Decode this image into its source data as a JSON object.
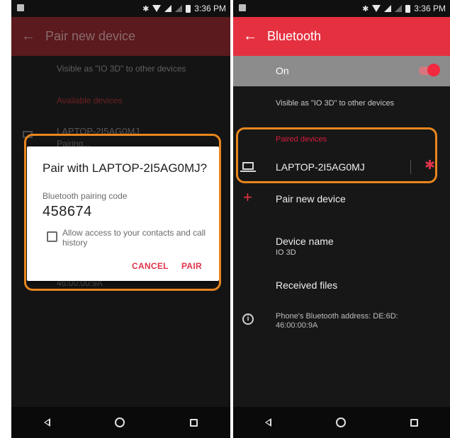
{
  "status_bar": {
    "time": "3:36 PM"
  },
  "left_screen": {
    "title": "Pair new device",
    "visible_as": "Visible as \"IO 3D\" to other devices",
    "available_devices_label": "Available devices",
    "device_name": "LAPTOP-2I5AG0MJ",
    "device_status": "Pairing...",
    "dimmed_address": "46:00:00:9A",
    "dialog": {
      "title": "Pair with LAPTOP-2I5AG0MJ?",
      "code_label": "Bluetooth pairing code",
      "code": "458674",
      "checkbox_label": "Allow access to your contacts and call history",
      "checkbox_checked": false,
      "cancel_label": "CANCEL",
      "pair_label": "PAIR"
    }
  },
  "right_screen": {
    "title": "Bluetooth",
    "toggle_label": "On",
    "toggle_on": true,
    "visible_as": "Visible as \"IO 3D\" to other devices",
    "paired_devices_label": "Paired devices",
    "paired_device": "LAPTOP-2I5AG0MJ",
    "pair_new_label": "Pair new device",
    "device_name_label": "Device name",
    "device_name_value": "IO 3D",
    "received_files_label": "Received files",
    "address_text": "Phone's Bluetooth address: DE:6D: 46:00:00:9A"
  },
  "colors": {
    "accent_red": "#e53040",
    "highlight_orange": "#e8861e",
    "dark_background": "#171717"
  },
  "icons": {
    "left_screen": [
      "back-arrow-icon",
      "laptop-icon",
      "checkbox-icon"
    ],
    "right_screen": [
      "back-arrow-icon",
      "toggle-switch-icon",
      "laptop-icon",
      "gear-icon",
      "plus-icon",
      "info-icon"
    ],
    "navigation": [
      "nav-back-icon",
      "nav-home-icon",
      "nav-recents-icon"
    ]
  }
}
